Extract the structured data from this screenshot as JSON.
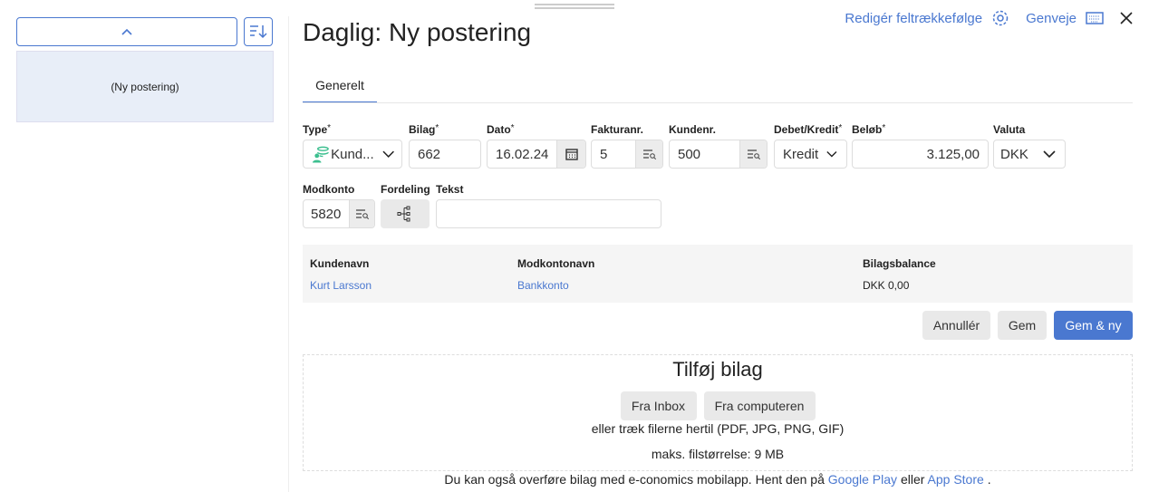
{
  "sidebar": {
    "list_item": "(Ny postering)"
  },
  "header": {
    "title": "Daglig: Ny postering",
    "edit_order": "Redigér feltrækkefølge",
    "shortcuts": "Genveje"
  },
  "tabs": [
    {
      "label": "Generelt",
      "active": true
    }
  ],
  "form": {
    "type": {
      "label": "Type",
      "value": "Kund..."
    },
    "bilag": {
      "label": "Bilag",
      "value": "662"
    },
    "dato": {
      "label": "Dato",
      "value": "16.02.24"
    },
    "fakturanr": {
      "label": "Fakturanr.",
      "value": "5"
    },
    "kundenr": {
      "label": "Kundenr.",
      "value": "500"
    },
    "debetkredit": {
      "label": "Debet/Kredit",
      "value": "Kredit"
    },
    "belob": {
      "label": "Beløb",
      "value": "3.125,00"
    },
    "valuta": {
      "label": "Valuta",
      "value": "DKK"
    },
    "modkonto": {
      "label": "Modkonto",
      "value": "5820"
    },
    "fordeling": {
      "label": "Fordeling"
    },
    "tekst": {
      "label": "Tekst",
      "value": ""
    },
    "required_mark": "*"
  },
  "summary": {
    "headers": [
      "Kundenavn",
      "Modkontonavn",
      "Bilagsbalance"
    ],
    "values": [
      "Kurt Larsson",
      "Bankkonto",
      "DKK 0,00"
    ]
  },
  "actions": {
    "cancel": "Annullér",
    "save": "Gem",
    "save_new": "Gem & ny"
  },
  "attach": {
    "title": "Tilføj bilag",
    "from_inbox": "Fra Inbox",
    "from_computer": "Fra computeren",
    "hint": "eller træk filerne hertil (PDF, JPG, PNG, GIF)",
    "max_size": "maks. filstørrelse: 9 MB"
  },
  "footer": {
    "text": "Du kan også overføre bilag med e-conomics mobilapp. Hent den på",
    "google_play": "Google Play",
    "or": "eller",
    "app_store": "App Store",
    "end": "."
  },
  "colors": {
    "accent": "#4a78d0",
    "type_icon": "#3cbf8f"
  }
}
